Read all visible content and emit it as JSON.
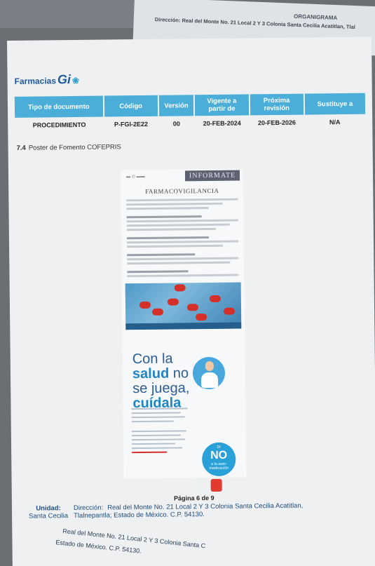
{
  "top_sheet": {
    "heading": "ORGANIGRAMA",
    "address": "Dirección: Real del Monte No. 21  Local 2 Y 3 Colonia Santa Cecilia Acatitlan, Tlal"
  },
  "header": {
    "logo_brand": "Farmacias",
    "logo_gi": "Gi",
    "logo_icon": "❀"
  },
  "doc_table": {
    "headers": [
      "Tipo de documento",
      "Código",
      "Versión",
      "Vigente a partir de",
      "Próxima revisión",
      "Sustituye a"
    ],
    "row": [
      "PROCEDIMIENTO",
      "P-FGI-2E22",
      "00",
      "20-FEB-2024",
      "20-FEB-2026",
      "N/A"
    ]
  },
  "section": {
    "number": "7.4",
    "title": "Poster de Fomento COFEPRIS"
  },
  "poster": {
    "badge": "INFORMATE",
    "title": "FARMACOVIGILANCIA",
    "slogan_line1": "Con la",
    "slogan_salud": "salud",
    "slogan_no": "no",
    "slogan_line3": "se juega,",
    "slogan_line4": "cuídala",
    "no_main": "NO",
    "no_di": "Di",
    "no_sub": "a la auto-medicación"
  },
  "footer": {
    "page_label": "Página 6 de 9",
    "unidad_label": "Unidad:",
    "unidad_value": "Santa Cecilia",
    "direccion_label": "Dirección:",
    "direccion_line1": "Real del Monte No. 21 Local 2 Y 3 Colonia Santa Cecilia Acatitlan,",
    "direccion_line2": "Tlalnepantla; Estado de México. C.P. 54130."
  },
  "under_sheet": {
    "line1": "Real del Monte No. 21 Local 2 Y 3 Colonia Santa C",
    "line2": "Estado de México. C.P. 54130."
  }
}
